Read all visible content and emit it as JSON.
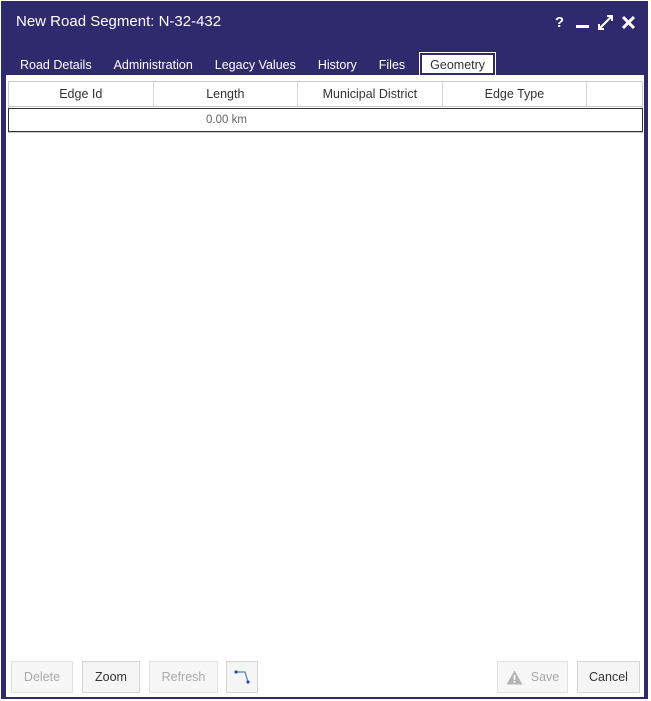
{
  "window": {
    "title": "New Road Segment: N-32-432",
    "controls": [
      "help-icon",
      "minimize-icon",
      "maximize-icon",
      "close-icon"
    ],
    "help_label": "?"
  },
  "tabs": [
    {
      "label": "Road Details",
      "active": false
    },
    {
      "label": "Administration",
      "active": false
    },
    {
      "label": "Legacy Values",
      "active": false
    },
    {
      "label": "History",
      "active": false
    },
    {
      "label": "Files",
      "active": false
    },
    {
      "label": "Geometry",
      "active": true
    }
  ],
  "grid": {
    "columns": [
      "Edge Id",
      "Length",
      "Municipal District",
      "Edge Type"
    ],
    "rows": [
      {
        "edge_id": "",
        "length": "0.00 km",
        "municipal_district": "",
        "edge_type": ""
      }
    ]
  },
  "footer": {
    "delete_label": "Delete",
    "zoom_label": "Zoom",
    "refresh_label": "Refresh",
    "draw_icon": "polyline-edit-icon",
    "save_label": "Save",
    "cancel_label": "Cancel"
  },
  "colors": {
    "window_bg": "#2f2a6e",
    "content_bg": "#ffffff",
    "disabled_text": "#a9a9a9"
  }
}
